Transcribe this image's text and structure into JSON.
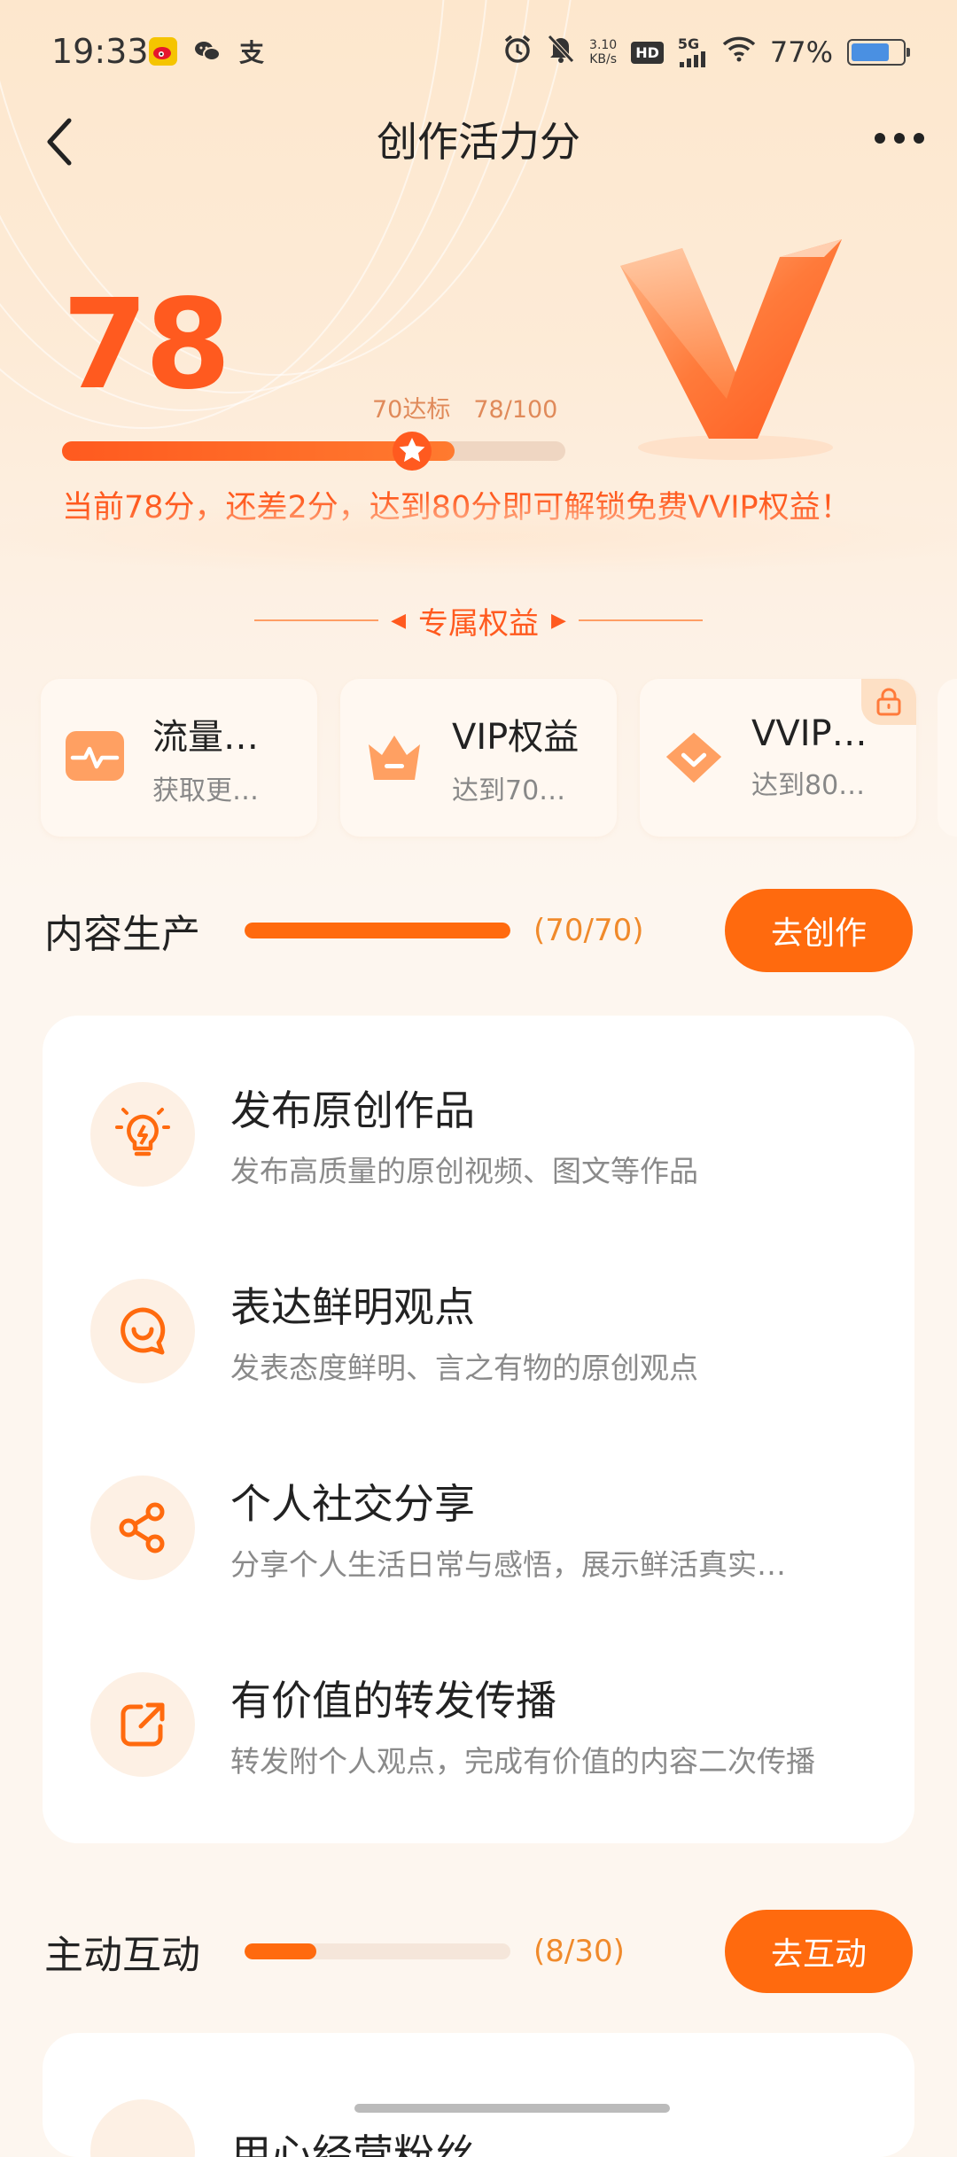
{
  "status_bar": {
    "time": "19:33",
    "app_icons": [
      "weibo-icon",
      "wechat-icon",
      "alipay-icon"
    ],
    "net_speed_value": "3.10",
    "net_speed_unit": "KB/s",
    "hd": "HD",
    "network": "5G",
    "battery": "77%",
    "battery_level": 0.77
  },
  "nav": {
    "title": "创作活力分"
  },
  "hero": {
    "score": "78",
    "target_label": "70达标",
    "progress_label": "78/100",
    "progress": 0.78,
    "tip": "当前78分，还差2分，达到80分即可解锁免费VVIP权益！"
  },
  "section": {
    "title": "专属权益"
  },
  "benefits": [
    {
      "title": "流量…",
      "sub": "获取更…",
      "icon": "pulse-icon",
      "locked": false
    },
    {
      "title": "VIP权益",
      "sub": "达到70…",
      "icon": "crown-icon",
      "locked": false
    },
    {
      "title": "VVIP…",
      "sub": "达到80…",
      "icon": "diamond-icon",
      "locked": true
    }
  ],
  "groups": [
    {
      "title": "内容生产",
      "count": "(70/70)",
      "progress": 1.0,
      "button": "去创作",
      "tasks": [
        {
          "title": "发布原创作品",
          "sub": "发布高质量的原创视频、图文等作品",
          "icon": "lightbulb-icon"
        },
        {
          "title": "表达鲜明观点",
          "sub": "发表态度鲜明、言之有物的原创观点",
          "icon": "chat-smile-icon"
        },
        {
          "title": "个人社交分享",
          "sub": "分享个人生活日常与感悟，展示鲜活真实…",
          "icon": "share-icon"
        },
        {
          "title": "有价值的转发传播",
          "sub": "转发附个人观点，完成有价值的内容二次传播",
          "icon": "forward-icon"
        }
      ]
    },
    {
      "title": "主动互动",
      "count": "(8/30)",
      "progress": 0.27,
      "button": "去互动",
      "tasks": [
        {
          "title": "用心经营粉丝",
          "sub": "",
          "icon": "fans-icon"
        }
      ]
    }
  ],
  "colors": {
    "accent": "#ff6a0e",
    "score": "#ff5a1f",
    "count": "#f08a2b"
  }
}
